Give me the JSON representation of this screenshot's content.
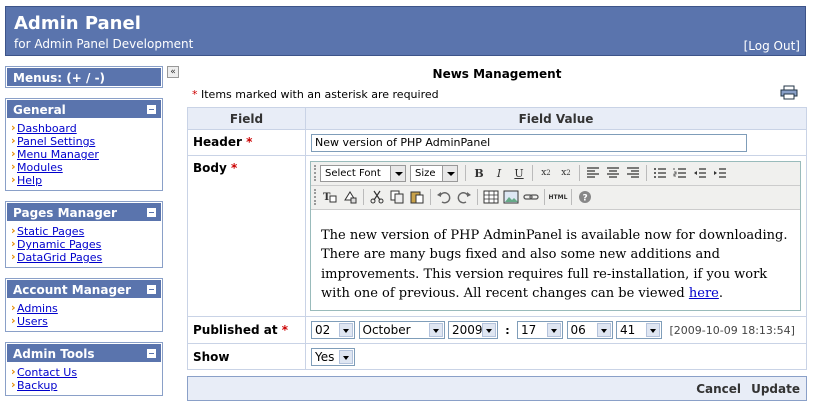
{
  "header": {
    "title": "Admin Panel",
    "subtitle": "for Admin Panel Development",
    "logout": "[Log Out]"
  },
  "sidebar": {
    "menus_label": "Menus: (+ / -)",
    "sections": [
      {
        "title": "General",
        "items": [
          "Dashboard",
          "Panel Settings",
          "Menu Manager",
          "Modules",
          "Help"
        ]
      },
      {
        "title": "Pages Manager",
        "items": [
          "Static Pages",
          "Dynamic Pages",
          "DataGrid Pages"
        ]
      },
      {
        "title": "Account Manager",
        "items": [
          "Admins",
          "Users"
        ]
      },
      {
        "title": "Admin Tools",
        "items": [
          "Contact Us",
          "Backup"
        ]
      }
    ]
  },
  "main": {
    "title": "News Management",
    "required_note": "Items marked with an asterisk are required",
    "columns": {
      "field": "Field",
      "value": "Field Value"
    },
    "fields": {
      "header_label": "Header",
      "header_value": "New version of PHP AdminPanel",
      "body_label": "Body",
      "published_label": "Published at",
      "show_label": "Show"
    },
    "editor": {
      "font_select": "Select Font",
      "size_select": "Size",
      "html_label": "HTML",
      "body_text": "The new version of PHP AdminPanel is available now for downloading. There are many bugs fixed and also some new additions and improvements. This version requires full re-installation, if you work with one of previous. All recent changes can be viewed ",
      "link_text": "here",
      "trailing": "."
    },
    "published": {
      "day": "02",
      "month": "October",
      "year": "2009",
      "hour": "17",
      "minute": "06",
      "second": "41",
      "timestamp": "[2009-10-09 18:13:54]"
    },
    "show_value": "Yes",
    "buttons": {
      "cancel": "Cancel",
      "update": "Update"
    }
  },
  "colors": {
    "header_bg": "#5a74ad",
    "link": "#0000cc",
    "required": "#cc0000"
  }
}
